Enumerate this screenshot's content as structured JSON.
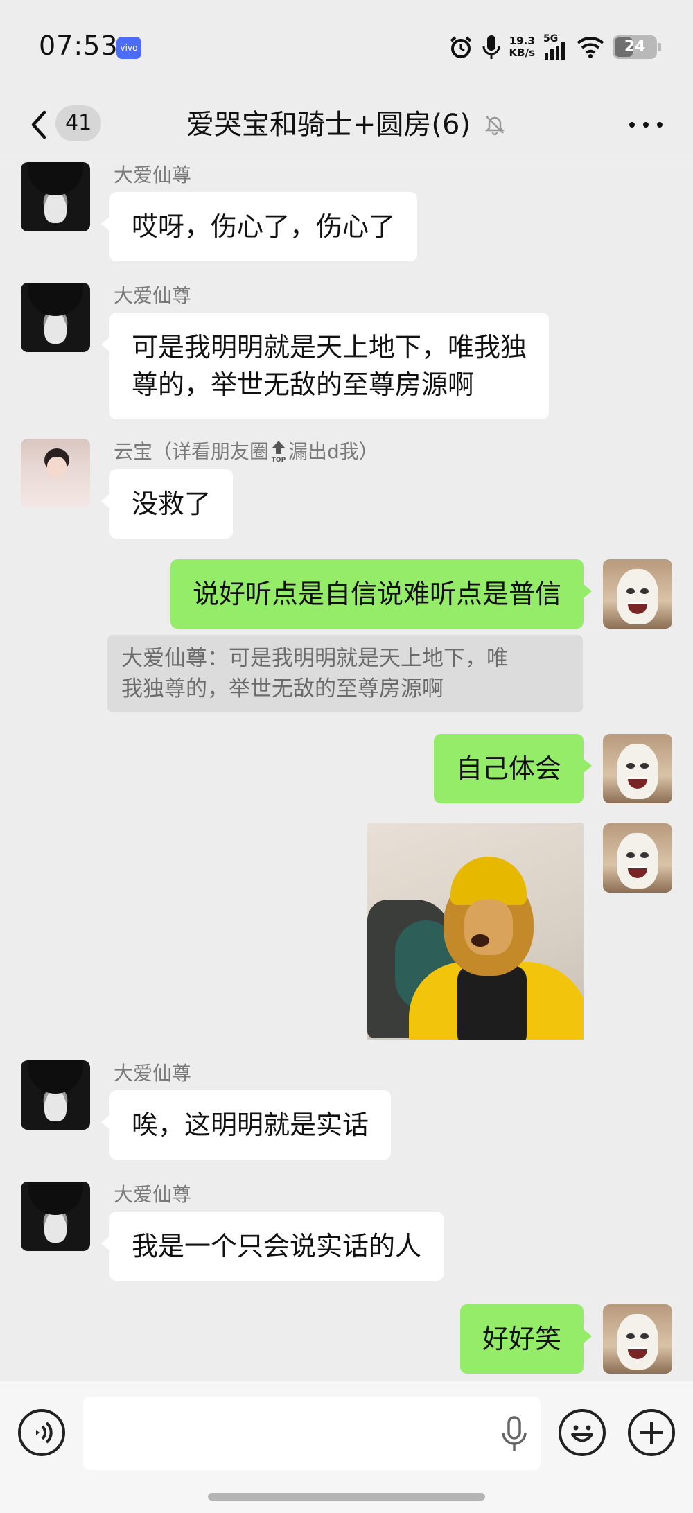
{
  "status_bar": {
    "time": "07:53",
    "brand": "vivo",
    "speed_value": "19.3",
    "speed_unit": "KB/s",
    "network": "5G",
    "battery": "24"
  },
  "header": {
    "unread_count": "41",
    "title": "爱哭宝和骑士+圆房(6)"
  },
  "messages": [
    {
      "side": "in",
      "sender": "大爱仙尊",
      "text": "哎呀，伤心了，伤心了",
      "avatar": "dark-hair-avatar"
    },
    {
      "side": "in",
      "sender": "大爱仙尊",
      "text_lines": [
        "可是我明明就是天上地下，唯我独",
        "尊的，举世无敌的至尊房源啊"
      ],
      "avatar": "dark-hair-avatar"
    },
    {
      "side": "in",
      "sender_prefix": "云宝（详看朋友圈",
      "sender_top": "TOP",
      "sender_suffix": "漏出d我）",
      "text": "没救了",
      "avatar": "girl-avatar"
    },
    {
      "side": "out",
      "text": "说好听点是自信说难听点是普信",
      "avatar": "cat-avatar"
    },
    {
      "quote_lines": [
        "大爱仙尊：可是我明明就是天上地下，唯",
        "我独尊的，举世无敌的至尊房源啊"
      ]
    },
    {
      "side": "out",
      "text": "自己体会",
      "avatar": "cat-avatar"
    },
    {
      "side": "out",
      "type": "sticker",
      "sticker": "monkey-king-sticker",
      "avatar": "cat-avatar"
    },
    {
      "side": "in",
      "sender": "大爱仙尊",
      "text": "唉，这明明就是实话",
      "avatar": "dark-hair-avatar"
    },
    {
      "side": "in",
      "sender": "大爱仙尊",
      "text": "我是一个只会说实话的人",
      "avatar": "dark-hair-avatar"
    },
    {
      "side": "out",
      "text": "好好笑",
      "avatar": "cat-avatar"
    }
  ],
  "input_bar": {
    "voice_icon": "voice-mode-icon",
    "mic_icon": "microphone-icon",
    "emoji_icon": "emoji-icon",
    "plus_icon": "plus-icon"
  },
  "colors": {
    "background": "#ededed",
    "outgoing_bubble": "#95ec69",
    "incoming_bubble": "#ffffff",
    "quote_bg": "#dcdcdc"
  }
}
